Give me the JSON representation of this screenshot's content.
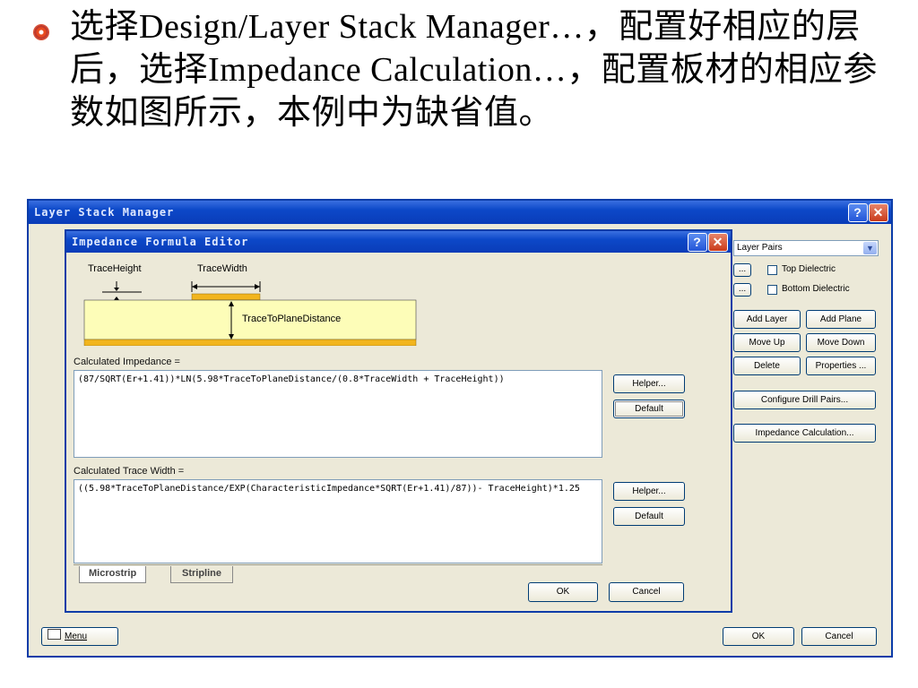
{
  "slide": {
    "text": "选择Design/Layer Stack Manager…，配置好相应的层后，选择Impedance Calculation…，配置板材的相应参数如图所示，本例中为缺省值。"
  },
  "outer_dialog": {
    "title": "Layer Stack Manager",
    "help_glyph": "?",
    "close_glyph": "✕",
    "layer_pairs": "Layer Pairs",
    "small_btn": "...",
    "top_dielectric": "Top Dielectric",
    "bottom_dielectric": "Bottom Dielectric",
    "add_layer": "Add Layer",
    "add_plane": "Add Plane",
    "move_up": "Move Up",
    "move_down": "Move Down",
    "delete": "Delete",
    "properties": "Properties ...",
    "configure_drill": "Configure Drill Pairs...",
    "impedance_calc": "Impedance Calculation...",
    "menu": "Menu",
    "ok": "OK",
    "cancel": "Cancel"
  },
  "inner_dialog": {
    "title": "Impedance Formula Editor",
    "help_glyph": "?",
    "close_glyph": "✕",
    "diagram": {
      "trace_height": "TraceHeight",
      "trace_width": "TraceWidth",
      "trace_to_plane": "TraceToPlaneDistance"
    },
    "impedance_label": "Calculated Impedance =",
    "impedance_formula": "(87/SQRT(Er+1.41))*LN(5.98*TraceToPlaneDistance/(0.8*TraceWidth + TraceHeight))",
    "width_label": "Calculated Trace Width =",
    "width_formula": "((5.98*TraceToPlaneDistance/EXP(CharacteristicImpedance*SQRT(Er+1.41)/87))- TraceHeight)*1.25",
    "helper": "Helper...",
    "default": "Default",
    "tab_microstrip": "Microstrip",
    "tab_stripline": "Stripline",
    "ok": "OK",
    "cancel": "Cancel"
  },
  "colors": {
    "title_bar": "#0a3cb8",
    "dialog_bg": "#ece9d8",
    "dielectric": "#fdfdb8",
    "copper": "#f2b51e"
  }
}
